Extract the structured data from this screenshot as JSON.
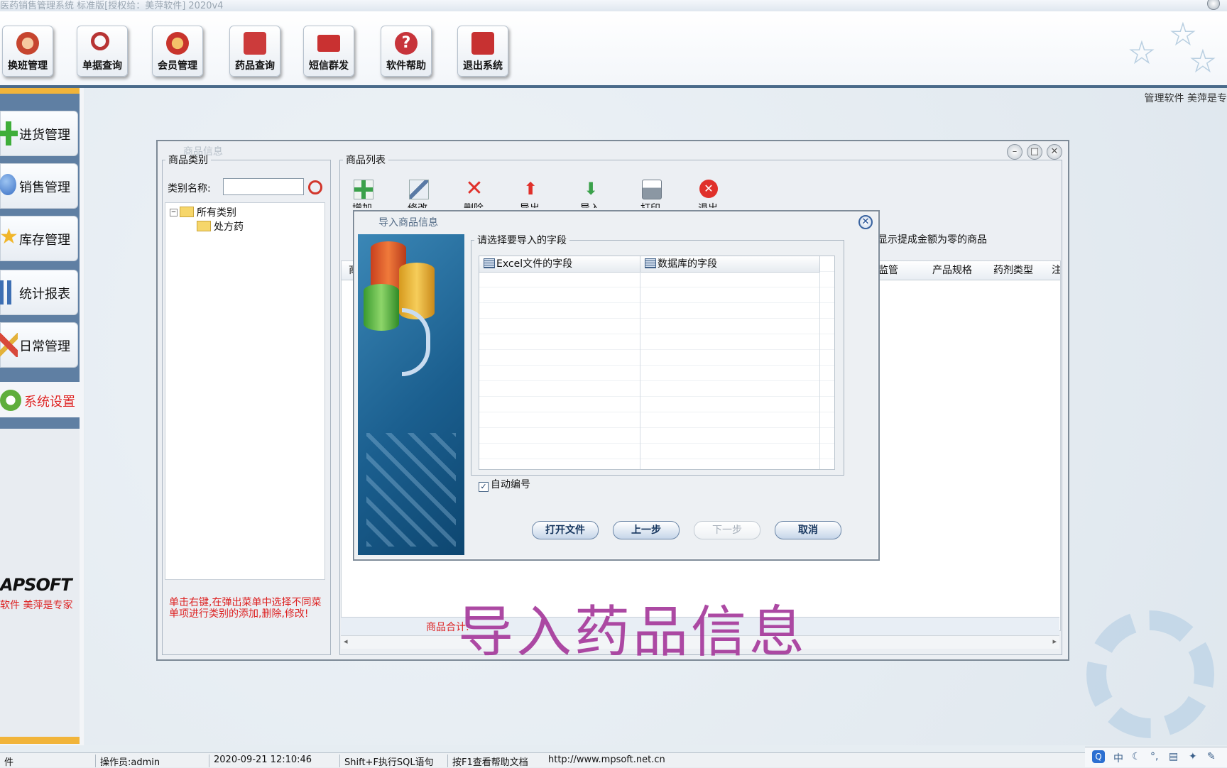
{
  "window": {
    "title": "医药销售管理系统 标准版[授权给：美萍软件] 2020v4"
  },
  "toolbar": {
    "buttons": [
      {
        "label": "换班管理",
        "icon": "person-icon",
        "color": "#c6452f"
      },
      {
        "label": "单据查询",
        "icon": "magnifier-icon",
        "color": "#b73434"
      },
      {
        "label": "会员管理",
        "icon": "member-icon",
        "color": "#c8342c"
      },
      {
        "label": "药品查询",
        "icon": "medicine-icon",
        "color": "#cc3b3b"
      },
      {
        "label": "短信群发",
        "icon": "envelope-icon",
        "color": "#c93131"
      },
      {
        "label": "软件帮助",
        "icon": "help-icon",
        "color": "#c7343b"
      },
      {
        "label": "退出系统",
        "icon": "power-icon",
        "color": "#c73131"
      }
    ]
  },
  "brandline": "管理软件 美萍是专",
  "sidebar": {
    "items": [
      {
        "label": "进货管理",
        "icon": "plus-icon",
        "color": "#3fae3a"
      },
      {
        "label": "销售管理",
        "icon": "globe-icon",
        "color": "#3a6fc4"
      },
      {
        "label": "库存管理",
        "icon": "star-icon",
        "color": "#f1b62a"
      },
      {
        "label": "统计报表",
        "icon": "bar-chart-icon",
        "color": "#3d6fb3"
      },
      {
        "label": "日常管理",
        "icon": "tools-icon",
        "color": "#d8483a"
      }
    ],
    "system_setting": "系统设置",
    "brand_logo": "APSOFT",
    "brand_slogan": "软件 美萍是专家"
  },
  "product_window": {
    "title": "商品信息",
    "category": {
      "legend": "商品类别",
      "name_label": "类别名称:",
      "name_value": "",
      "tree": {
        "root": "所有类别",
        "child": "处方药"
      },
      "hint": "单击右键,在弹出菜单中选择不同菜单项进行类别的添加,删除,修改!"
    },
    "list": {
      "legend": "商品列表",
      "tools": [
        {
          "label": "增加",
          "icon": "add-icon"
        },
        {
          "label": "修改",
          "icon": "edit-icon"
        },
        {
          "label": "删除",
          "icon": "delete-icon"
        },
        {
          "label": "导出",
          "icon": "export-icon"
        },
        {
          "label": "导入",
          "icon": "import-icon"
        },
        {
          "label": "打印",
          "icon": "printer-icon"
        },
        {
          "label": "退出",
          "icon": "exit-icon"
        }
      ],
      "hide_option": "显示提成金额为零的商品",
      "columns": [
        "商",
        "监管",
        "产品规格",
        "药剂类型",
        "注册"
      ],
      "summary": "商品合计:"
    }
  },
  "import_dialog": {
    "title": "导入商品信息",
    "fields_legend": "请选择要导入的字段",
    "columns": [
      "Excel文件的字段",
      "数据库的字段"
    ],
    "auto_number": "自动编号",
    "auto_number_checked": true,
    "buttons": {
      "open_file": "打开文件",
      "prev": "上一步",
      "next": "下一步",
      "cancel": "取消"
    }
  },
  "caption": "导入药品信息",
  "statusbar": {
    "items": [
      "件",
      "操作员:admin",
      "2020-09-21 12:10:46",
      "Shift+F执行SQL语句",
      "按F1查看帮助文档",
      "http://www.mpsoft.net.cn"
    ]
  },
  "tray": {
    "ime": "中"
  }
}
